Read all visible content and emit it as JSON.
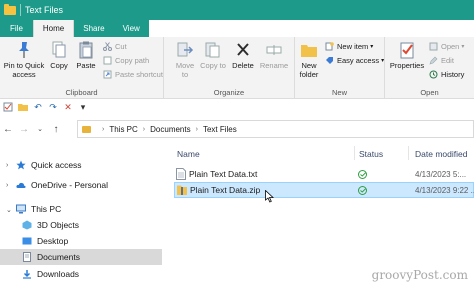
{
  "window": {
    "title": "Text Files"
  },
  "tabs": [
    {
      "label": "File"
    },
    {
      "label": "Home"
    },
    {
      "label": "Share"
    },
    {
      "label": "View"
    }
  ],
  "ribbon": {
    "clipboard": {
      "label": "Clipboard",
      "pin": "Pin to Quick access",
      "copy": "Copy",
      "paste": "Paste",
      "cut": "Cut",
      "copy_path": "Copy path",
      "paste_shortcut": "Paste shortcut"
    },
    "organize": {
      "label": "Organize",
      "move_to": "Move to",
      "copy_to": "Copy to",
      "delete": "Delete",
      "rename": "Rename"
    },
    "new": {
      "label": "New",
      "new_folder": "New folder",
      "new_item": "New item",
      "easy_access": "Easy access"
    },
    "open": {
      "label": "Open",
      "properties": "Properties",
      "open": "Open",
      "edit": "Edit",
      "history": "History"
    }
  },
  "breadcrumb": [
    "This PC",
    "Documents",
    "Text Files"
  ],
  "nav_pane": {
    "quick_access": "Quick access",
    "onedrive": "OneDrive - Personal",
    "this_pc": "This PC",
    "objects3d": "3D Objects",
    "desktop": "Desktop",
    "documents": "Documents",
    "downloads": "Downloads"
  },
  "columns": {
    "name": "Name",
    "status": "Status",
    "date": "Date modified"
  },
  "files": [
    {
      "name": "Plain Text Data.txt",
      "date": "4/13/2023 5:..."
    },
    {
      "name": "Plain Text Data.zip",
      "date": "4/13/2023 9:22 ..."
    }
  ],
  "watermark": "groovyPost.com",
  "colors": {
    "titlebar": "#1e9a8a",
    "selection": "#cce8ff",
    "status_ok": "#2e9e3e"
  },
  "icons": [
    "folder-icon",
    "pin-icon",
    "copy-icon",
    "paste-icon",
    "cut-icon",
    "move-to-icon",
    "copy-to-icon",
    "delete-icon",
    "rename-icon",
    "new-folder-icon",
    "new-item-icon",
    "easy-access-icon",
    "properties-icon",
    "open-icon",
    "edit-icon",
    "history-icon",
    "back-icon",
    "forward-icon",
    "up-icon",
    "sync-ok-icon",
    "cursor-icon"
  ]
}
